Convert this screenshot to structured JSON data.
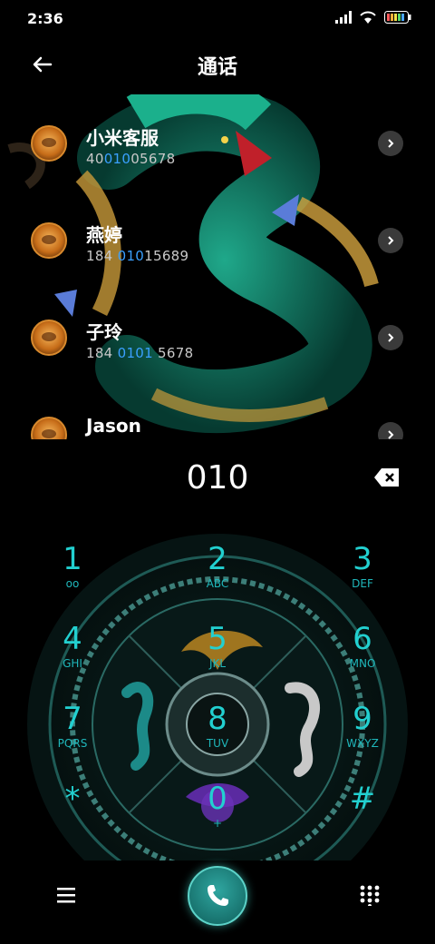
{
  "status": {
    "time": "2:36"
  },
  "header": {
    "title": "通话",
    "back_icon": "arrow-left-icon"
  },
  "contacts": [
    {
      "name": "小米客服",
      "num_pre": "40",
      "num_hl": "010",
      "num_post": "05678"
    },
    {
      "name": "燕婷",
      "num_pre": "184 ",
      "num_hl": "010",
      "num_post": "15689"
    },
    {
      "name": "子玲",
      "num_pre": "184 ",
      "num_hl": "0101",
      "num_post": " 5678"
    },
    {
      "name": "Jason",
      "num_pre": "",
      "num_hl": "",
      "num_post": ""
    }
  ],
  "dialed_number": "010",
  "keys": [
    {
      "digit": "1",
      "letters": "ᴏᴏ"
    },
    {
      "digit": "2",
      "letters": "ABC"
    },
    {
      "digit": "3",
      "letters": "DEF"
    },
    {
      "digit": "4",
      "letters": "GHI"
    },
    {
      "digit": "5",
      "letters": "JKL"
    },
    {
      "digit": "6",
      "letters": "MNO"
    },
    {
      "digit": "7",
      "letters": "PQRS"
    },
    {
      "digit": "8",
      "letters": "TUV"
    },
    {
      "digit": "9",
      "letters": "WXYZ"
    },
    {
      "digit": "*",
      "letters": ""
    },
    {
      "digit": "0",
      "letters": "+"
    },
    {
      "digit": "#",
      "letters": ""
    }
  ],
  "colors": {
    "accent": "#22d0d0",
    "highlight": "#3aa0ff",
    "call": "#1f8a84"
  }
}
